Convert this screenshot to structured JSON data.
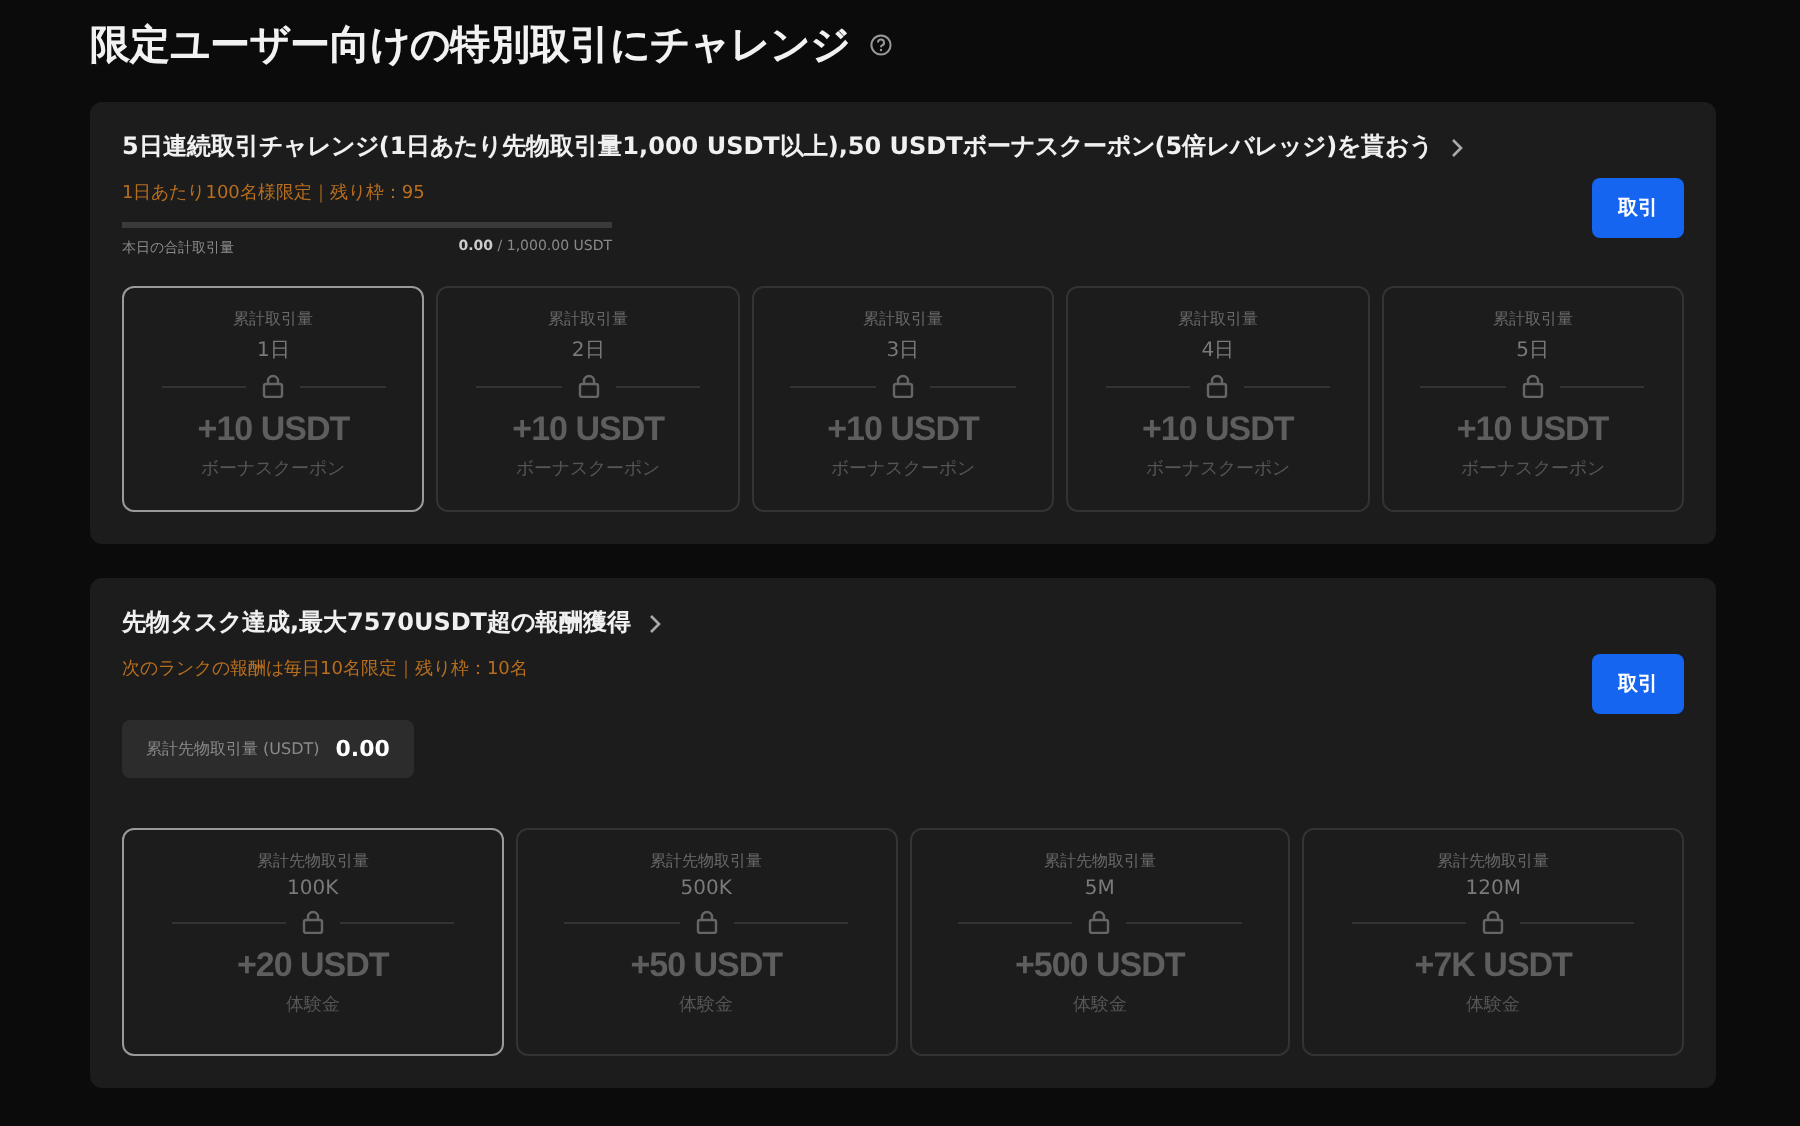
{
  "page": {
    "title": "限定ユーザー向けの特別取引にチャレンジ"
  },
  "challenges": [
    {
      "title": "5日連続取引チャレンジ(1日あたり先物取引量1,000 USDT以上),50 USDTボーナスクーポン(5倍レバレッジ)を貰おう",
      "note": "1日あたり100名様限定｜残り枠：95",
      "button": "取引",
      "progress": {
        "kind": "bar",
        "label": "本日の合計取引量",
        "current": "0.00",
        "target": "/ 1,000.00 USDT"
      },
      "tiers": [
        {
          "caption": "累計取引量",
          "goal": "1日",
          "reward": "+10 USDT",
          "reward_type": "ボーナスクーポン",
          "selected": true
        },
        {
          "caption": "累計取引量",
          "goal": "2日",
          "reward": "+10 USDT",
          "reward_type": "ボーナスクーポン",
          "selected": false
        },
        {
          "caption": "累計取引量",
          "goal": "3日",
          "reward": "+10 USDT",
          "reward_type": "ボーナスクーポン",
          "selected": false
        },
        {
          "caption": "累計取引量",
          "goal": "4日",
          "reward": "+10 USDT",
          "reward_type": "ボーナスクーポン",
          "selected": false
        },
        {
          "caption": "累計取引量",
          "goal": "5日",
          "reward": "+10 USDT",
          "reward_type": "ボーナスクーポン",
          "selected": false
        }
      ]
    },
    {
      "title": "先物タスク達成,最大7570USDT超の報酬獲得",
      "note": "次のランクの報酬は毎日10名限定｜残り枠：10名",
      "button": "取引",
      "progress": {
        "kind": "stat",
        "label": "累計先物取引量 (USDT)",
        "current": "0.00"
      },
      "tiers": [
        {
          "caption": "累計先物取引量",
          "goal": "100K",
          "reward": "+20 USDT",
          "reward_type": "体験金",
          "selected": true
        },
        {
          "caption": "累計先物取引量",
          "goal": "500K",
          "reward": "+50 USDT",
          "reward_type": "体験金",
          "selected": false
        },
        {
          "caption": "累計先物取引量",
          "goal": "5M",
          "reward": "+500 USDT",
          "reward_type": "体験金",
          "selected": false
        },
        {
          "caption": "累計先物取引量",
          "goal": "120M",
          "reward": "+7K USDT",
          "reward_type": "体験金",
          "selected": false
        }
      ]
    }
  ]
}
